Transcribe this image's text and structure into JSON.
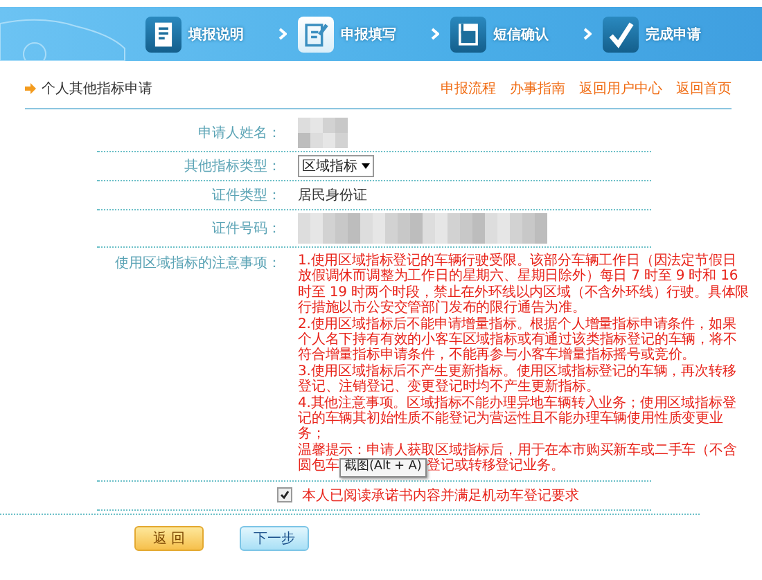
{
  "steps": [
    {
      "label": "填报说明",
      "selected": false
    },
    {
      "label": "申报填写",
      "selected": true
    },
    {
      "label": "短信确认",
      "selected": false
    },
    {
      "label": "完成申请",
      "selected": false
    }
  ],
  "page_title": "个人其他指标申请",
  "links": [
    "申报流程",
    "办事指南",
    "返回用户中心",
    "返回首页"
  ],
  "form": {
    "name_label": "申请人姓名：",
    "type_label": "其他指标类型：",
    "type_value": "区域指标",
    "id_type_label": "证件类型：",
    "id_type_value": "居民身份证",
    "id_number_label": "证件号码：",
    "notice_label": "使用区域指标的注意事项：",
    "notice_lines": [
      "1.使用区域指标登记的车辆行驶受限。该部分车辆工作日（因法定节假日",
      "放假调休而调整为工作日的星期六、星期日除外）每日 7 时至 9 时和 16",
      "时至 19 时两个时段，禁止在外环线以内区域（不含外环线）行驶。具体限",
      "行措施以市公安交管部门发布的限行通告为准。",
      "2.使用区域指标后不能申请增量指标。根据个人增量指标申请条件，如果",
      "个人名下持有有效的小客车区域指标或有通过该类指标登记的车辆，将不",
      "符合增量指标申请条件，不能再参与小客车增量指标摇号或竞价。",
      "3.使用区域指标后不产生更新指标。使用区域指标登记的车辆，再次转移",
      "登记、注销登记、变更登记时均不产生更新指标。",
      "4.其他注意事项。区域指标不能办理异地车辆转入业务；使用区域指标登",
      "记的车辆其初始性质不能登记为营运性且不能办理车辆使用性质变更业",
      "务；",
      "温馨提示：申请人获取区域指标后，用于在本市购买新车或二手车（不含"
    ],
    "notice_last_before": "圆包车",
    "tooltip": "截图(Alt + A)",
    "notice_last_after": "登记或转移登记业务。",
    "agree_label": "本人已阅读承诺书内容并满足机动车登记要求",
    "agree_checked": true
  },
  "buttons": [
    "返 回",
    "下一步"
  ]
}
